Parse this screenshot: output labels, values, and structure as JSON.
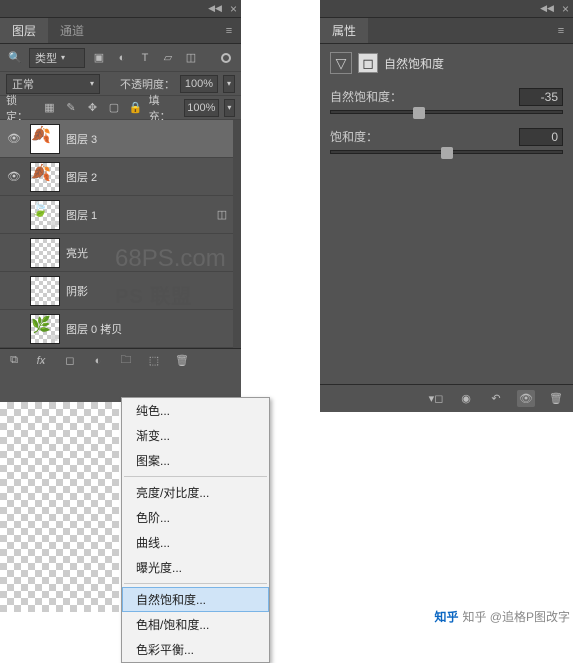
{
  "leftPanel": {
    "tabs": [
      "图层",
      "通道"
    ],
    "filterLabel": "类型",
    "blendMode": "正常",
    "opacityLabel": "不透明度：",
    "opacityValue": "100%",
    "lockLabel": "锁定：",
    "fillLabel": "填充：",
    "fillValue": "100%",
    "layers": [
      {
        "name": "图层 3",
        "visible": true,
        "selected": true,
        "thumb": "leaf"
      },
      {
        "name": "图层 2",
        "visible": true,
        "selected": false,
        "thumb": "leaf"
      },
      {
        "name": "图层 1",
        "visible": false,
        "selected": false,
        "thumb": "group"
      },
      {
        "name": "亮光",
        "visible": false,
        "selected": false,
        "thumb": "checker"
      },
      {
        "name": "阴影",
        "visible": false,
        "selected": false,
        "thumb": "checker"
      },
      {
        "name": "图层 0 拷贝",
        "visible": false,
        "selected": false,
        "thumb": "leaf-green"
      }
    ]
  },
  "adjustMenu": {
    "items1": [
      "纯色...",
      "渐变...",
      "图案..."
    ],
    "items2": [
      "亮度/对比度...",
      "色阶...",
      "曲线...",
      "曝光度..."
    ],
    "items3": [
      "自然饱和度...",
      "色相/饱和度...",
      "色彩平衡..."
    ],
    "selected": "自然饱和度..."
  },
  "rightPanel": {
    "tab": "属性",
    "adjustName": "自然饱和度",
    "sliders": [
      {
        "label": "自然饱和度：",
        "value": "-35",
        "pos": 38
      },
      {
        "label": "饱和度：",
        "value": "0",
        "pos": 50
      }
    ]
  },
  "watermark1": "68PS.com",
  "watermark2": "PS 联盟",
  "zhihu": "知乎 @追格P图改字"
}
